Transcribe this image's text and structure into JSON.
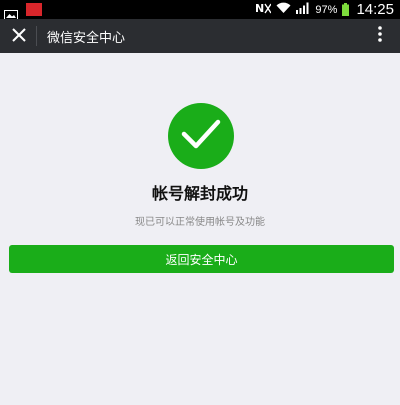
{
  "status_bar": {
    "battery_percent": "97%",
    "time": "14:25",
    "colors": {
      "background": "#000000",
      "battery": "#7ddc3c"
    }
  },
  "app_bar": {
    "title": "微信安全中心",
    "close_icon": "close-icon",
    "more_icon": "more-vertical-icon",
    "background": "#2b2d31"
  },
  "result": {
    "icon": "check-circle-icon",
    "title": "帐号解封成功",
    "description": "现已可以正常使用帐号及功能",
    "accent": "#1aad19"
  },
  "actions": {
    "primary_label": "返回安全中心"
  },
  "page": {
    "background": "#efeff4"
  }
}
